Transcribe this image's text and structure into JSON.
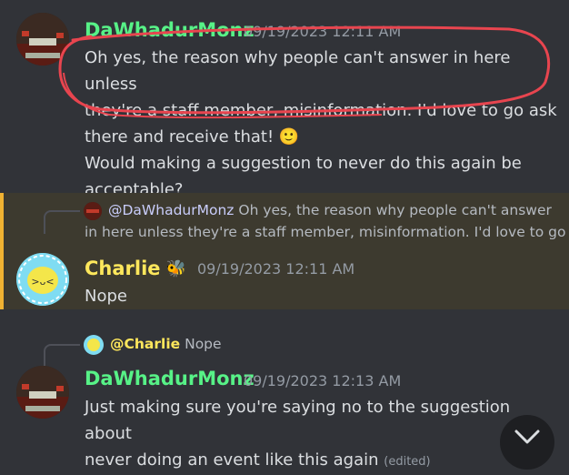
{
  "messages": [
    {
      "author": "DaWhadurMonz",
      "timestamp": "09/19/2023 12:11 AM",
      "lines": [
        "Oh yes, the reason why people can't answer in here unless",
        "they're a staff member, misinformation. I'd love to go ask",
        "there and receive that! 🙂",
        "Would making a suggestion to never do this again be",
        "acceptable?"
      ]
    },
    {
      "reply": {
        "mention": "@DaWhadurMonz",
        "line1": "Oh yes, the reason why people can't answer",
        "line2": "in here unless they're a staff member, misinformation. I'd love to go"
      },
      "author": "Charlie",
      "badge": "🐝",
      "timestamp": "09/19/2023 12:11 AM",
      "text": "Nope"
    },
    {
      "reply": {
        "mention": "@Charlie",
        "text": "Nope"
      },
      "author": "DaWhadurMonz",
      "timestamp": "09/19/2023 12:13 AM",
      "lines": [
        "Just making sure you're saying no to the suggestion about",
        "never doing an event like this again"
      ],
      "edited": "(edited)"
    }
  ],
  "colors": {
    "background": "#313338",
    "username_green": "#57f287",
    "username_yellow": "#fee75c",
    "highlight": "#3d3a2f",
    "annotation_red": "#e8454f"
  },
  "icons": {
    "scroll_down": "chevron-down-icon"
  }
}
